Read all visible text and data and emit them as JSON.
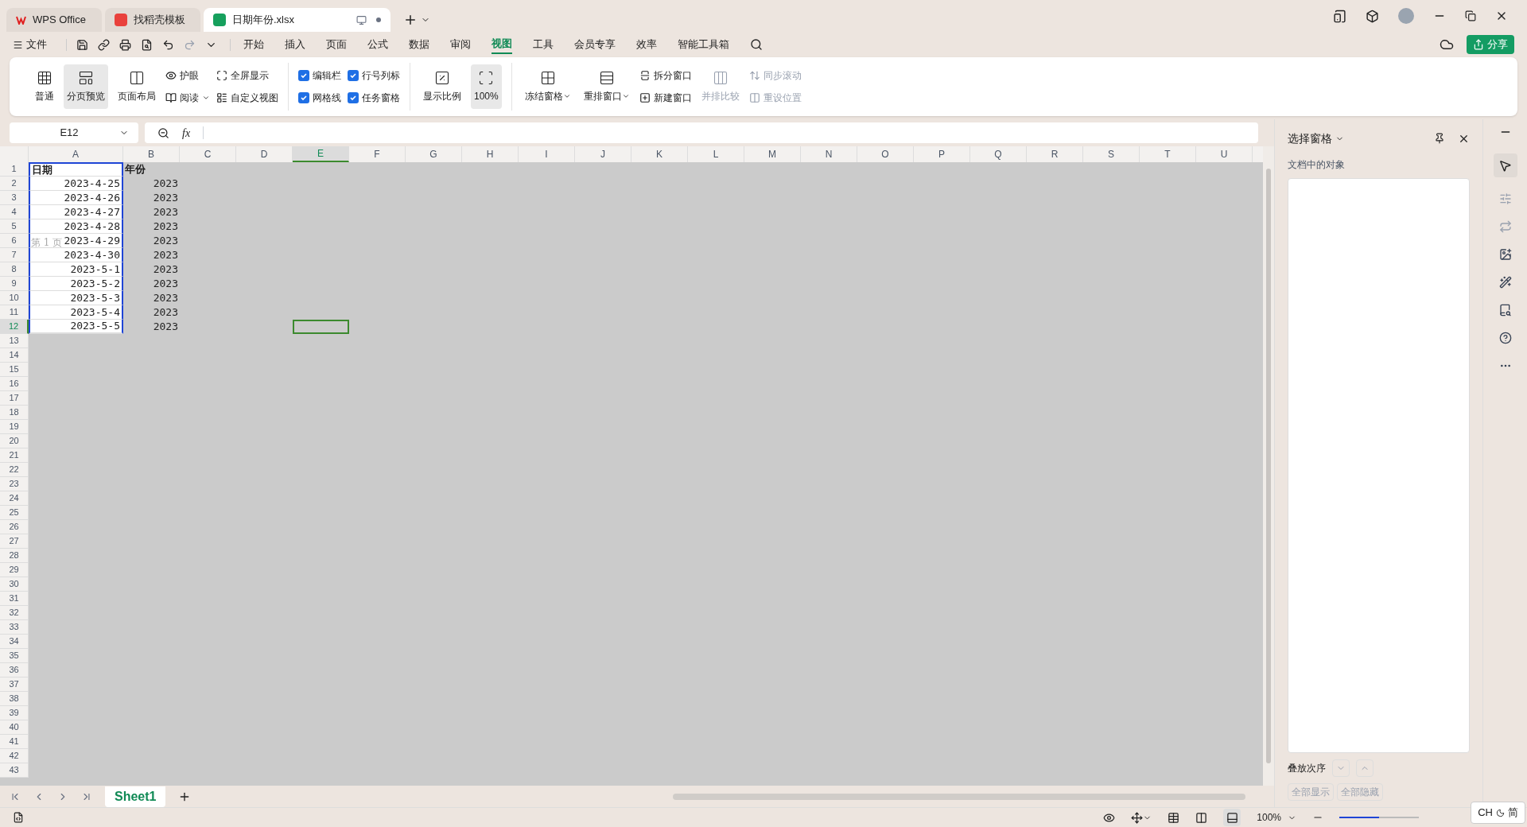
{
  "title_tabs": [
    {
      "kind": "wps",
      "label": "WPS Office",
      "selected": false
    },
    {
      "kind": "template",
      "label": "找稻壳模板",
      "selected": false
    },
    {
      "kind": "sheet",
      "label": "日期年份.xlsx",
      "selected": true
    }
  ],
  "menu": {
    "file": "文件",
    "items": [
      {
        "label": "开始",
        "selected": false
      },
      {
        "label": "插入",
        "selected": false
      },
      {
        "label": "页面",
        "selected": false
      },
      {
        "label": "公式",
        "selected": false
      },
      {
        "label": "数据",
        "selected": false
      },
      {
        "label": "审阅",
        "selected": false
      },
      {
        "label": "视图",
        "selected": true
      },
      {
        "label": "工具",
        "selected": false
      },
      {
        "label": "会员专享",
        "selected": false
      },
      {
        "label": "效率",
        "selected": false
      },
      {
        "label": "智能工具箱",
        "selected": false
      }
    ],
    "share": "分享"
  },
  "ribbon": [
    [
      {
        "kind": "big",
        "label": "普通",
        "selected": false,
        "dropdown": false,
        "disabled": false
      },
      {
        "kind": "big",
        "label": "分页预览",
        "selected": true,
        "dropdown": false,
        "disabled": false
      },
      {
        "kind": "big",
        "label": "页面布局",
        "selected": false,
        "dropdown": false,
        "disabled": false
      },
      {
        "kind": "stack",
        "items": [
          {
            "label": "护眼",
            "dropdown": false,
            "disabled": false
          },
          {
            "label": "阅读",
            "dropdown": true,
            "disabled": false
          }
        ]
      },
      {
        "kind": "stack",
        "items": [
          {
            "label": "全屏显示",
            "dropdown": false,
            "disabled": false
          },
          {
            "label": "自定义视图",
            "dropdown": false,
            "disabled": false
          }
        ]
      }
    ],
    [
      {
        "kind": "checks",
        "items": [
          {
            "label": "编辑栏",
            "checked": true
          },
          {
            "label": "网格线",
            "checked": true
          }
        ]
      },
      {
        "kind": "checks",
        "items": [
          {
            "label": "行号列标",
            "checked": true
          },
          {
            "label": "任务窗格",
            "checked": true
          }
        ]
      }
    ],
    [
      {
        "kind": "big",
        "label": "显示比例",
        "selected": false,
        "dropdown": false,
        "disabled": false
      },
      {
        "kind": "big",
        "label": "100%",
        "selected": true,
        "dropdown": false,
        "disabled": false
      }
    ],
    [
      {
        "kind": "big",
        "label": "冻结窗格",
        "selected": false,
        "dropdown": true,
        "disabled": false
      },
      {
        "kind": "big",
        "label": "重排窗口",
        "selected": false,
        "dropdown": true,
        "disabled": false
      },
      {
        "kind": "stack",
        "items": [
          {
            "label": "拆分窗口",
            "dropdown": false,
            "disabled": false
          },
          {
            "label": "新建窗口",
            "dropdown": false,
            "disabled": false
          }
        ]
      },
      {
        "kind": "big",
        "label": "并排比较",
        "selected": false,
        "dropdown": false,
        "disabled": true
      },
      {
        "kind": "stack",
        "items": [
          {
            "label": "同步滚动",
            "dropdown": false,
            "disabled": true
          },
          {
            "label": "重设位置",
            "dropdown": false,
            "disabled": true
          }
        ]
      }
    ]
  ],
  "name_box": "E12",
  "columns": [
    {
      "label": "A",
      "selected": false
    },
    {
      "label": "B",
      "selected": false
    },
    {
      "label": "C",
      "selected": false
    },
    {
      "label": "D",
      "selected": false
    },
    {
      "label": "E",
      "selected": true
    },
    {
      "label": "F",
      "selected": false
    },
    {
      "label": "G",
      "selected": false
    },
    {
      "label": "H",
      "selected": false
    },
    {
      "label": "I",
      "selected": false
    },
    {
      "label": "J",
      "selected": false
    },
    {
      "label": "K",
      "selected": false
    },
    {
      "label": "L",
      "selected": false
    },
    {
      "label": "M",
      "selected": false
    },
    {
      "label": "N",
      "selected": false
    },
    {
      "label": "O",
      "selected": false
    },
    {
      "label": "P",
      "selected": false
    },
    {
      "label": "Q",
      "selected": false
    },
    {
      "label": "R",
      "selected": false
    },
    {
      "label": "S",
      "selected": false
    },
    {
      "label": "T",
      "selected": false
    },
    {
      "label": "U",
      "selected": false
    }
  ],
  "formula_label": "fx",
  "rows": [
    {
      "label": "1",
      "selected": false
    },
    {
      "label": "2",
      "selected": false
    },
    {
      "label": "3",
      "selected": false
    },
    {
      "label": "4",
      "selected": false
    },
    {
      "label": "5",
      "selected": false
    },
    {
      "label": "6",
      "selected": false
    },
    {
      "label": "7",
      "selected": false
    },
    {
      "label": "8",
      "selected": false
    },
    {
      "label": "9",
      "selected": false
    },
    {
      "label": "10",
      "selected": false
    },
    {
      "label": "11",
      "selected": false
    },
    {
      "label": "12",
      "selected": true
    },
    {
      "label": "13",
      "selected": false
    },
    {
      "label": "14",
      "selected": false
    },
    {
      "label": "15",
      "selected": false
    },
    {
      "label": "16",
      "selected": false
    },
    {
      "label": "17",
      "selected": false
    },
    {
      "label": "18",
      "selected": false
    },
    {
      "label": "19",
      "selected": false
    },
    {
      "label": "20",
      "selected": false
    },
    {
      "label": "21",
      "selected": false
    },
    {
      "label": "22",
      "selected": false
    },
    {
      "label": "23",
      "selected": false
    },
    {
      "label": "24",
      "selected": false
    },
    {
      "label": "25",
      "selected": false
    },
    {
      "label": "26",
      "selected": false
    },
    {
      "label": "27",
      "selected": false
    },
    {
      "label": "28",
      "selected": false
    },
    {
      "label": "29",
      "selected": false
    },
    {
      "label": "30",
      "selected": false
    },
    {
      "label": "31",
      "selected": false
    },
    {
      "label": "32",
      "selected": false
    },
    {
      "label": "33",
      "selected": false
    },
    {
      "label": "34",
      "selected": false
    },
    {
      "label": "35",
      "selected": false
    },
    {
      "label": "36",
      "selected": false
    },
    {
      "label": "37",
      "selected": false
    },
    {
      "label": "38",
      "selected": false
    },
    {
      "label": "39",
      "selected": false
    },
    {
      "label": "40",
      "selected": false
    },
    {
      "label": "41",
      "selected": false
    },
    {
      "label": "42",
      "selected": false
    },
    {
      "label": "43",
      "selected": false
    }
  ],
  "cells": [
    [
      "日期",
      "年份"
    ],
    [
      "2023-4-25",
      "2023"
    ],
    [
      "2023-4-26",
      "2023"
    ],
    [
      "2023-4-27",
      "2023"
    ],
    [
      "2023-4-28",
      "2023"
    ],
    [
      "2023-4-29",
      "2023"
    ],
    [
      "2023-4-30",
      "2023"
    ],
    [
      "2023-5-1",
      "2023"
    ],
    [
      "2023-5-2",
      "2023"
    ],
    [
      "2023-5-3",
      "2023"
    ],
    [
      "2023-5-4",
      "2023"
    ],
    [
      "2023-5-5",
      "2023"
    ]
  ],
  "page_label": "第 1 页",
  "sheet_tabs": [
    {
      "label": "Sheet1",
      "selected": true
    }
  ],
  "pane": {
    "title": "选择窗格",
    "subtitle": "文档中的对象",
    "order_label": "叠放次序",
    "buttons": [
      "全部显示",
      "全部隐藏"
    ]
  },
  "status": {
    "zoom": "100%",
    "level": 0.5
  },
  "ime": {
    "lang": "CH",
    "mode": "简"
  }
}
